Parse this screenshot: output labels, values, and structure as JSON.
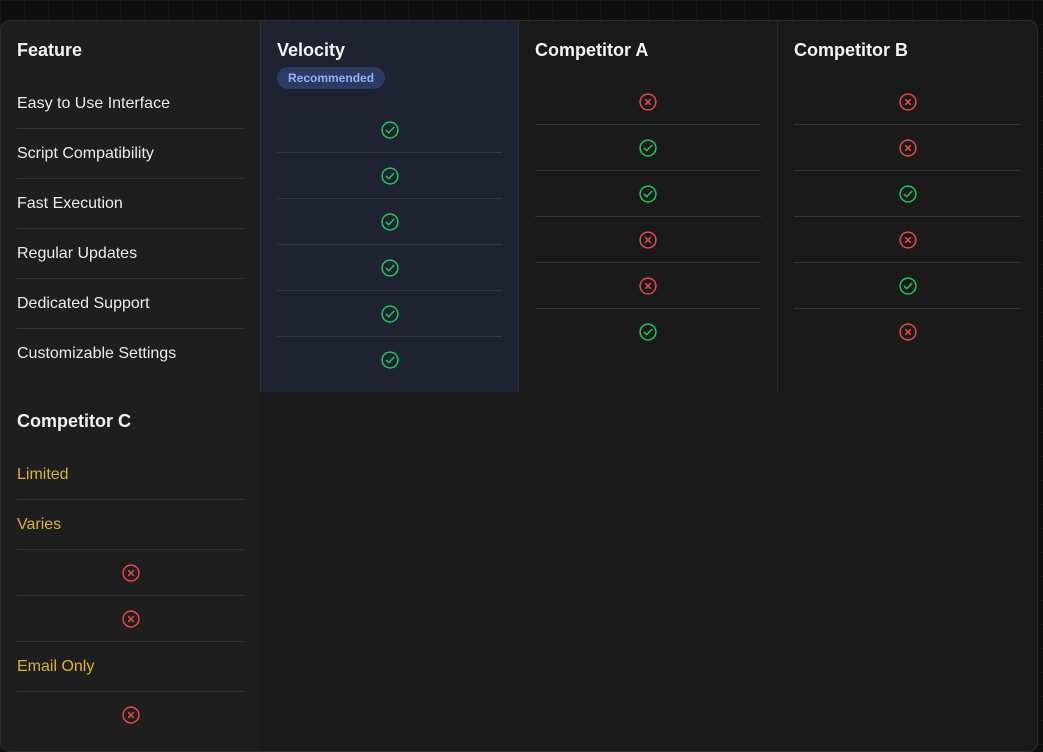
{
  "headers": {
    "feature": "Feature",
    "velocity": "Velocity",
    "competitor_a": "Competitor A",
    "competitor_b": "Competitor B",
    "competitor_c": "Competitor C"
  },
  "badge": "Recommended",
  "features": [
    "Easy to Use Interface",
    "Script Compatibility",
    "Fast Execution",
    "Regular Updates",
    "Dedicated Support",
    "Customizable Settings"
  ],
  "competitor_c_values": [
    "Limited",
    "Varies",
    "",
    "",
    "Email Only",
    ""
  ],
  "icons": {
    "check": "check-circle-icon",
    "cross": "x-circle-icon"
  },
  "colors": {
    "check": "#22c55e",
    "cross": "#e5484d",
    "text_value": "#d9b23c",
    "badge_bg": "#2b3b63",
    "badge_text": "#8fb2ff"
  }
}
